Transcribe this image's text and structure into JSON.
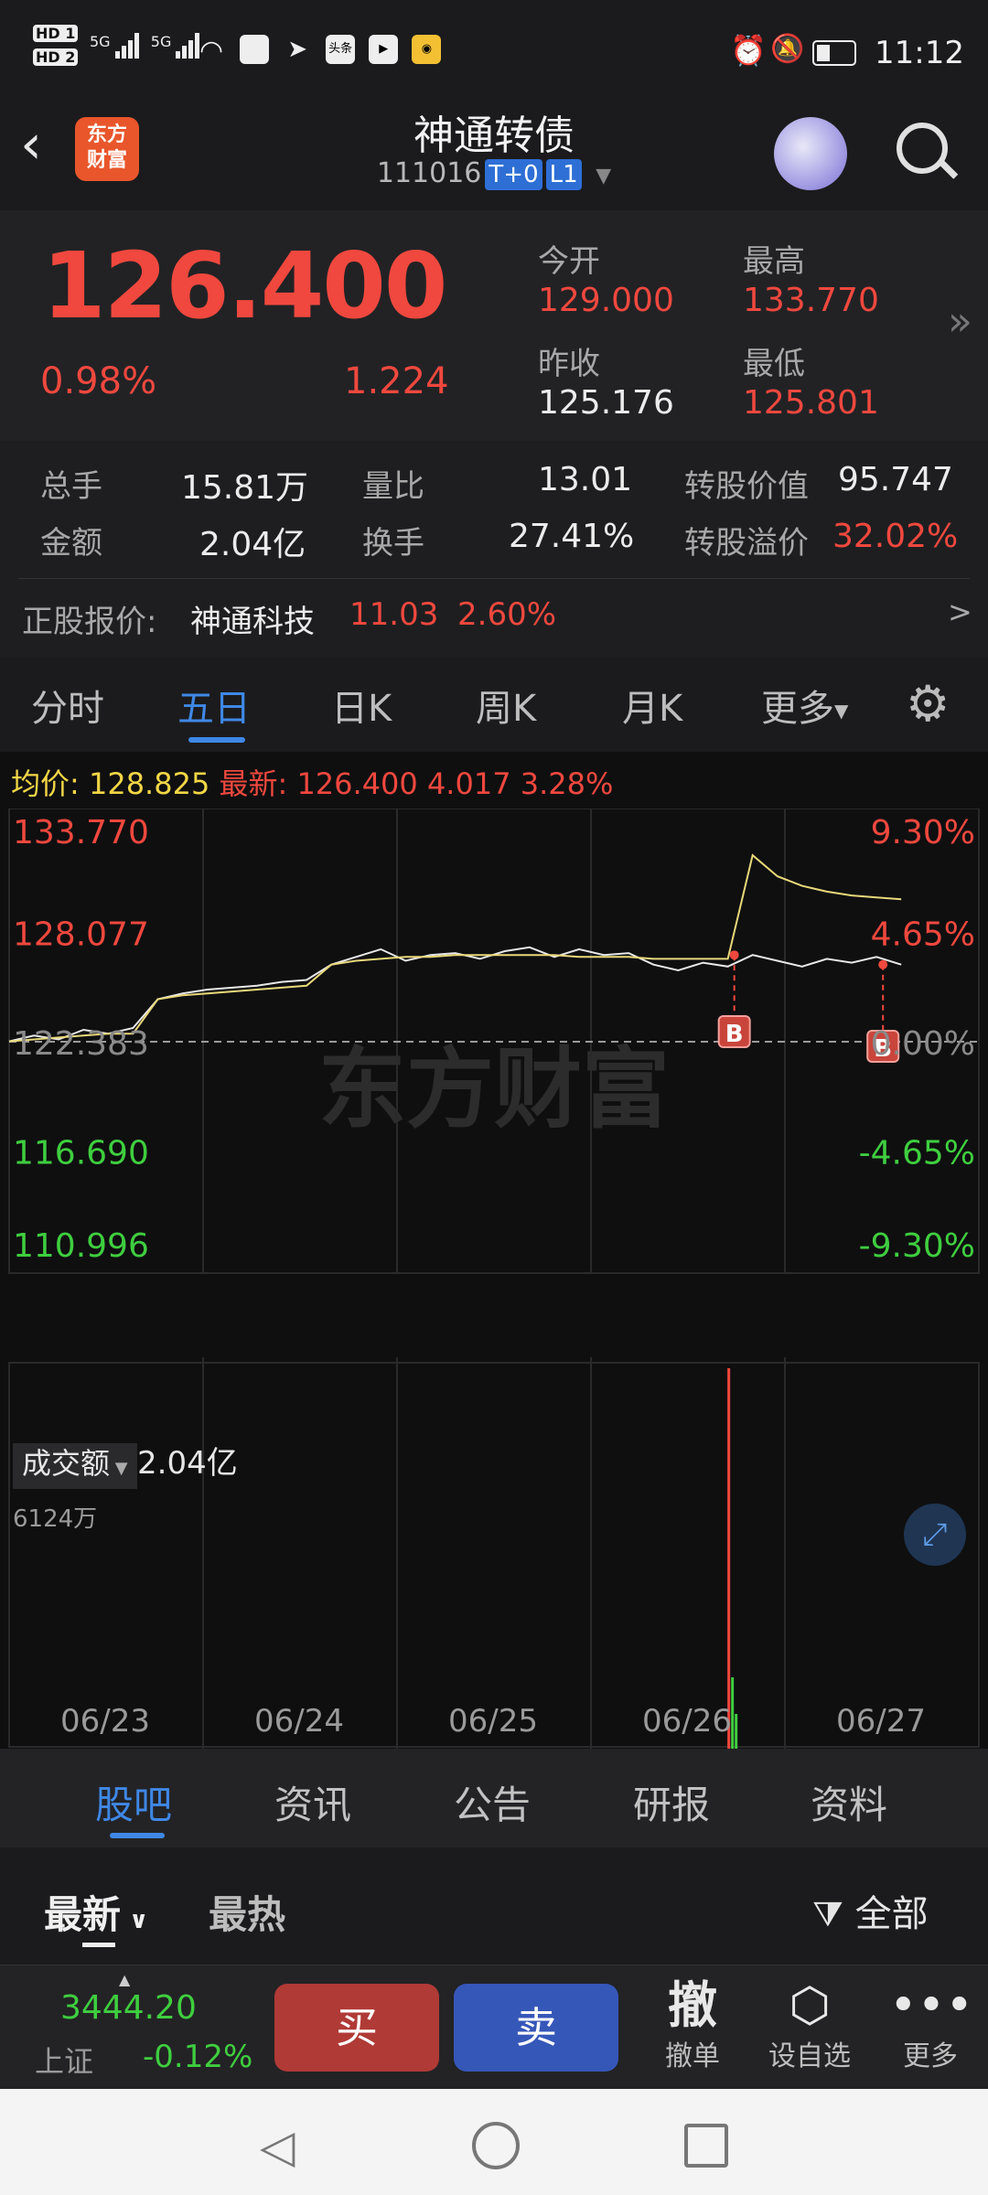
{
  "status_bar": {
    "time": "11:12",
    "sim1": "HD 1",
    "sim2": "HD 2",
    "net1": "5G",
    "net2": "5G",
    "app_icons": [
      "头条",
      "视频",
      "微博"
    ]
  },
  "header": {
    "title": "神通转债",
    "code": "111016",
    "tag1": "T+0",
    "tag2": "L1",
    "logo_line1": "东方",
    "logo_line2": "财富"
  },
  "quote": {
    "price": "126.400",
    "change_pct": "0.98%",
    "change": "1.224",
    "open_label": "今开",
    "open": "129.000",
    "high_label": "最高",
    "high": "133.770",
    "prev_close_label": "昨收",
    "prev_close": "125.176",
    "low_label": "最低",
    "low": "125.801"
  },
  "stats": {
    "volume_label": "总手",
    "volume": "15.81万",
    "vol_ratio_label": "量比",
    "vol_ratio": "13.01",
    "conv_value_label": "转股价值",
    "conv_value": "95.747",
    "amount_label": "金额",
    "amount": "2.04亿",
    "turnover_label": "换手",
    "turnover": "27.41%",
    "premium_label": "转股溢价",
    "premium": "32.02%",
    "underlying_label": "正股报价:",
    "underlying_name": "神通科技",
    "underlying_price": "11.03",
    "underlying_pct": "2.60%",
    "arrow": ">"
  },
  "tabs": {
    "items": [
      "分时",
      "五日",
      "日K",
      "周K",
      "月K",
      "更多"
    ],
    "active": "五日"
  },
  "chart": {
    "avg_label": "均价:",
    "avg_value": "128.825",
    "latest_label": "最新:",
    "latest_value": "126.400",
    "latest_change": "4.017",
    "latest_pct": "3.28%",
    "y_left": [
      "133.770",
      "128.077",
      "122.383",
      "116.690",
      "110.996"
    ],
    "y_right": [
      "9.30%",
      "4.65%",
      "0.00%",
      "-4.65%",
      "-9.30%"
    ],
    "watermark": "东方财富",
    "buy_marker": "B",
    "volume_selector": "成交额",
    "volume_total": "2.04亿",
    "volume_max": "6124万",
    "dates": [
      "06/23",
      "06/24",
      "06/25",
      "06/26",
      "06/27"
    ]
  },
  "chart_data": {
    "type": "line",
    "title": "",
    "ylim": [
      110.996,
      133.77
    ],
    "base": 122.383,
    "x_dates": [
      "06/23",
      "06/24",
      "06/25",
      "06/26",
      "06/27"
    ],
    "series": [
      {
        "name": "最新",
        "values": [
          122.4,
          122.7,
          122.5,
          123.0,
          122.8,
          123.1,
          124.6,
          124.9,
          125.1,
          125.2,
          125.3,
          125.5,
          125.6,
          126.4,
          126.8,
          127.2,
          126.6,
          126.9,
          127.0,
          126.7,
          127.1,
          127.3,
          126.8,
          127.2,
          126.9,
          127.0,
          126.4,
          126.1,
          126.5,
          126.3,
          126.9,
          126.6,
          126.3,
          126.7,
          126.5,
          126.8,
          126.4
        ]
      },
      {
        "name": "均价",
        "values": [
          122.4,
          122.5,
          122.6,
          122.7,
          122.8,
          122.8,
          124.6,
          124.8,
          124.9,
          125.0,
          125.1,
          125.2,
          125.3,
          126.4,
          126.6,
          126.7,
          126.8,
          126.8,
          126.9,
          126.9,
          126.9,
          126.9,
          126.9,
          126.8,
          126.8,
          126.8,
          126.7,
          126.7,
          126.7,
          126.7,
          132.1,
          131.0,
          130.5,
          130.2,
          130.0,
          129.9,
          129.8
        ]
      }
    ],
    "volume_max_label": "6124万",
    "volume_total": "2.04亿"
  },
  "bottom_tabs": {
    "items": [
      "股吧",
      "资讯",
      "公告",
      "研报",
      "资料"
    ],
    "active": "股吧"
  },
  "filters": {
    "latest": "最新",
    "hot": "最热",
    "all": "全部"
  },
  "action_bar": {
    "index_value": "3444.20",
    "index_name": "上证",
    "index_pct": "-0.12%",
    "buy": "买",
    "sell": "卖",
    "cancel_glyph": "撤",
    "cancel_label": "撤单",
    "watch_label": "设自选",
    "more_label": "更多"
  }
}
